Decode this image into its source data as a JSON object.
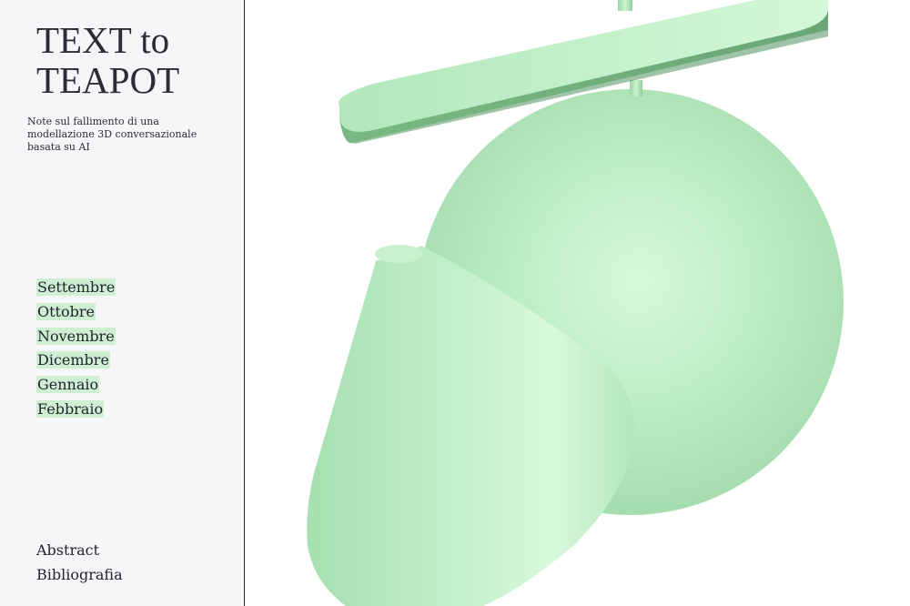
{
  "sidebar": {
    "title_lines": [
      "TEXT to",
      "TEAPOT"
    ],
    "subtitle_lines": [
      "Note sul fallimento di una",
      "modellazione 3D conversazionale",
      "basata su AI"
    ],
    "months": [
      {
        "label": "Settembre"
      },
      {
        "label": "Ottobre"
      },
      {
        "label": "Novembre"
      },
      {
        "label": "Dicembre"
      },
      {
        "label": "Gennaio"
      },
      {
        "label": "Febbraio"
      }
    ],
    "footer_links": [
      {
        "label": "Abstract"
      },
      {
        "label": "Bibliografia"
      }
    ]
  },
  "viewport": {
    "model_color": "#b8ecc0",
    "shapes": [
      "disc",
      "rod",
      "sphere",
      "cone"
    ]
  },
  "colors": {
    "sidebar_bg": "#f6f6f8",
    "text": "#2c2c36",
    "highlight": "#cfefd3",
    "divider": "#2b2b33"
  }
}
